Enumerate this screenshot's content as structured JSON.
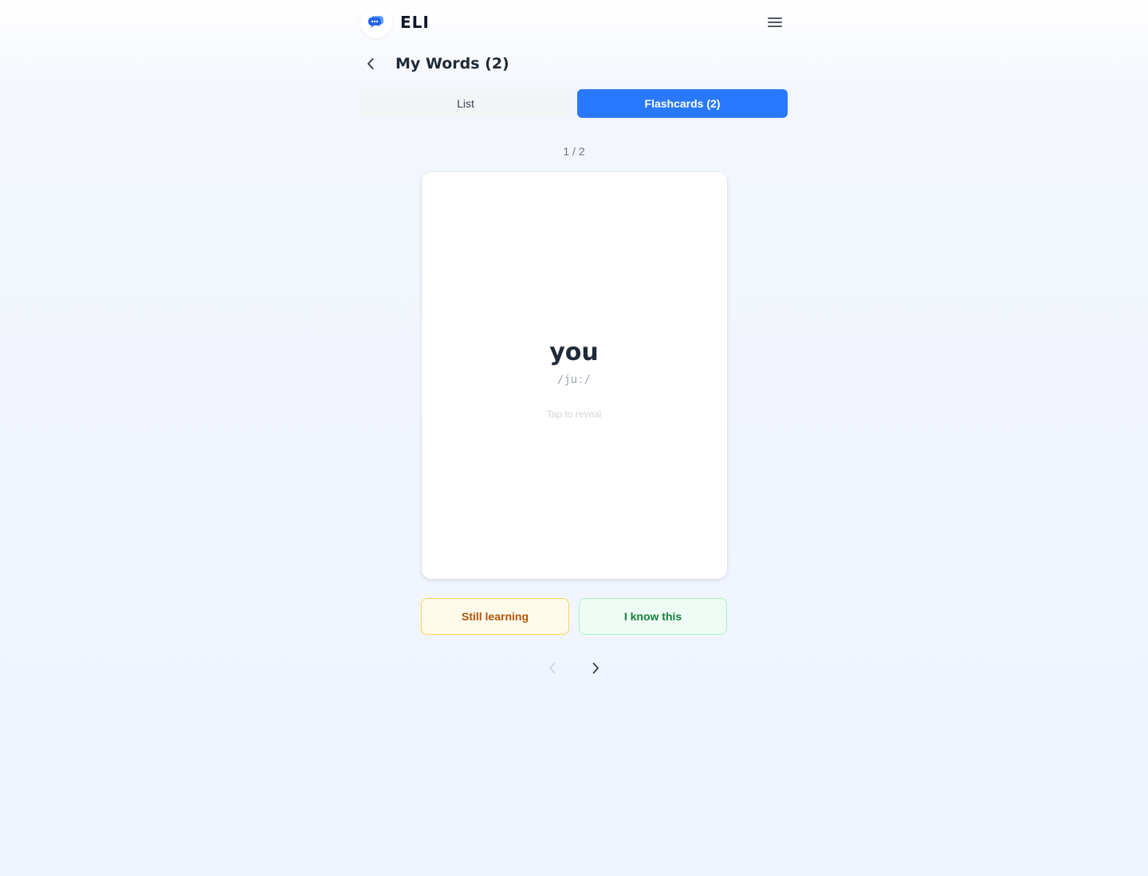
{
  "app": {
    "name": "ELI",
    "logo_icon": "chat-bubbles-icon",
    "menu_icon": "hamburger-menu-icon"
  },
  "page": {
    "title": "My Words (2)",
    "back_icon": "chevron-left-icon"
  },
  "tabs": [
    {
      "label": "List",
      "active": false
    },
    {
      "label": "Flashcards (2)",
      "active": true
    }
  ],
  "flashcard": {
    "counter": "1 / 2",
    "word": "you",
    "phonetic": "/juː/",
    "hint": "Tap to reveal"
  },
  "actions": {
    "still_learning_label": "Still learning",
    "know_this_label": "I know this"
  },
  "pager": {
    "prev_icon": "chevron-left-icon",
    "next_icon": "chevron-right-icon",
    "prev_disabled": true
  },
  "colors": {
    "accent": "#2979ff",
    "logo_blue": "#2563eb",
    "still_learning_text": "#b45309",
    "know_this_text": "#15803d"
  }
}
